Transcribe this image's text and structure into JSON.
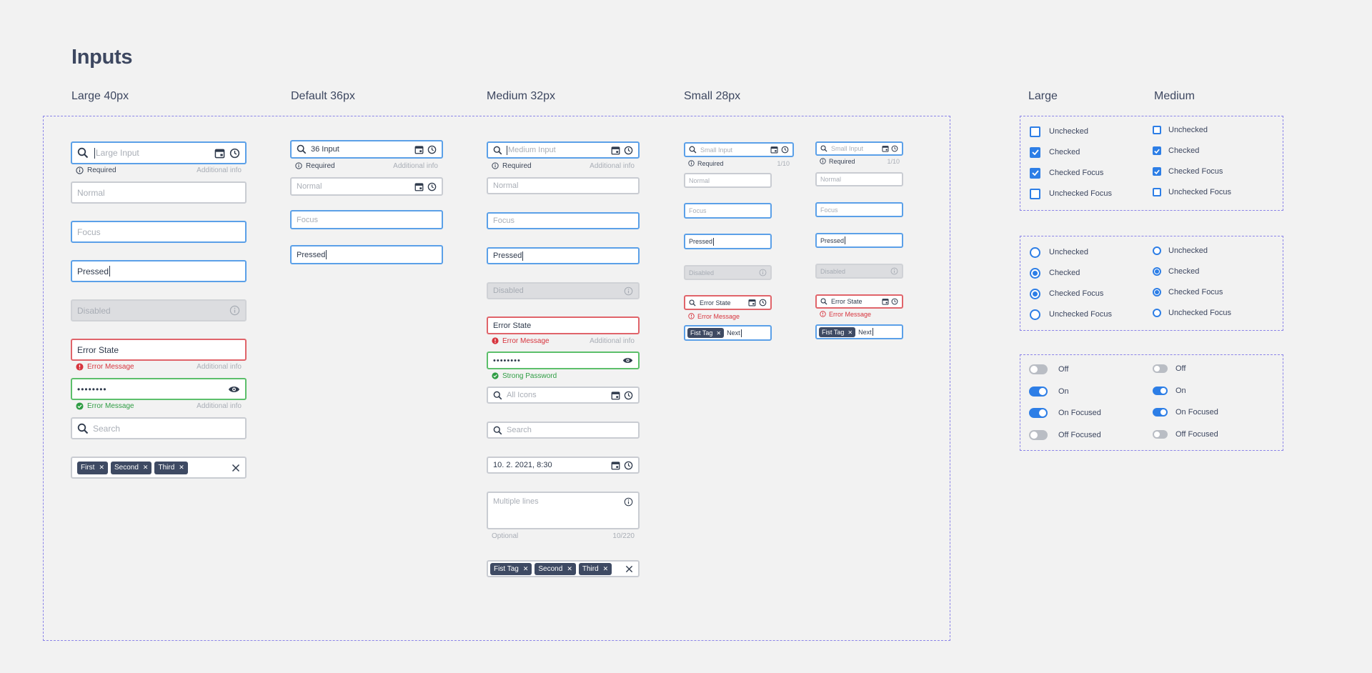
{
  "page_title": "Inputs",
  "headings": {
    "large": "Large 40px",
    "default": "Default 36px",
    "medium": "Medium 32px",
    "small": "Small 28px",
    "sel_large": "Large",
    "sel_medium": "Medium"
  },
  "texts": {
    "large_input_ph": "Large Input",
    "input_36": "36 Input",
    "medium_input_ph": "Medium Input",
    "small_input_ph": "Small Input",
    "required": "Required",
    "additional_info": "Additional info",
    "count_1_10": "1/10",
    "normal": "Normal",
    "focus": "Focus",
    "pressed": "Pressed",
    "disabled": "Disabled",
    "error_state": "Error State",
    "error_message": "Error Message",
    "password_mask": "••••••••",
    "strong_password": "Strong Password",
    "search": "Search",
    "all_icons": "All Icons",
    "datetime": "10. 2. 2021, 8:30",
    "multiple_lines": "Multiple lines",
    "optional": "Optional",
    "count_10_220": "10/220",
    "tag_first": "First",
    "tag_second": "Second",
    "tag_third": "Third",
    "tag_fist_tag": "Fist Tag",
    "tag_next": "Next"
  },
  "checkboxes": [
    "Unchecked",
    "Checked",
    "Checked Focus",
    "Unchecked Focus"
  ],
  "radios": [
    "Unchecked",
    "Checked",
    "Checked Focus",
    "Unchecked Focus"
  ],
  "toggles": [
    "Off",
    "On",
    "On Focused",
    "Off Focused"
  ],
  "icons": {
    "search": "search-icon",
    "calendar": "calendar-icon",
    "clock": "clock-icon",
    "info": "info-icon",
    "error": "error-icon",
    "success": "check-circle-icon",
    "eye": "eye-icon",
    "close": "close-icon"
  },
  "colors": {
    "focus_border": "#5ba0e8",
    "error": "#e0646a",
    "success": "#5cbf6b",
    "accent": "#2d7ee6",
    "tag_bg": "#3e4a63",
    "frame": "#8b84e8"
  }
}
